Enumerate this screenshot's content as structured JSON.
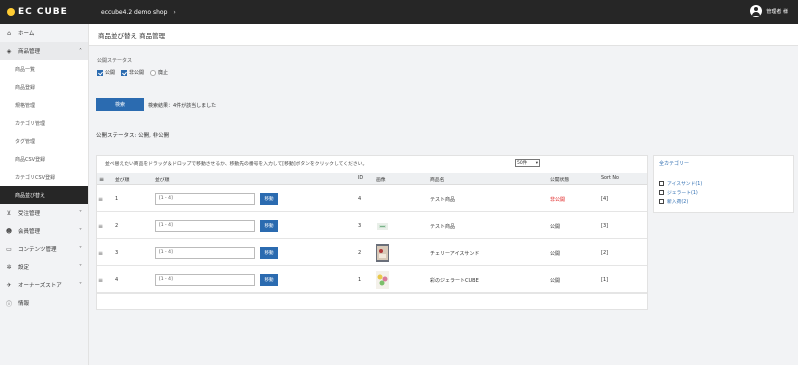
{
  "header": {
    "logo": "EC CUBE",
    "shop_name": "eccube4.2 demo shop",
    "user_name": "管理者 様"
  },
  "sidebar": {
    "items": [
      {
        "label": "ホーム",
        "icon": "home-icon"
      },
      {
        "label": "商品管理",
        "icon": "tag-icon"
      },
      {
        "label": "受注管理",
        "icon": "cart-icon"
      },
      {
        "label": "会員管理",
        "icon": "users-icon"
      },
      {
        "label": "コンテンツ管理",
        "icon": "monitor-icon"
      },
      {
        "label": "設定",
        "icon": "gear-icon"
      },
      {
        "label": "オーナーズストア",
        "icon": "store-icon"
      },
      {
        "label": "情報",
        "icon": "info-icon"
      }
    ],
    "sub_items": [
      "商品一覧",
      "商品登録",
      "規格管理",
      "カテゴリ管理",
      "タグ管理",
      "商品CSV登録",
      "カテゴリCSV登録",
      "商品並び替え"
    ]
  },
  "page": {
    "title": "商品並び替え  商品管理",
    "filter_label": "公開ステータス",
    "checks": [
      {
        "label": "公開",
        "checked": true
      },
      {
        "label": "非公開",
        "checked": true
      },
      {
        "label": "廃止",
        "checked": false
      }
    ],
    "search_label": "検索",
    "result_text": "検索結果：4件が該当しました",
    "status_line": "公開ステータス: 公開, 非公開"
  },
  "table": {
    "note": "並べ替えたい商品をドラッグ＆ドロップで移動させるか、移動先の番号を入力して[移動]ボタンをクリックしてください。",
    "per_page": "50件",
    "headers": [
      "並び順",
      "並び順",
      "ID",
      "画像",
      "商品名",
      "公開状態",
      "Sort No"
    ],
    "rows": [
      {
        "rank": "1",
        "input": "[1 - 4]",
        "move": "移動",
        "id": "4",
        "name": "テスト商品",
        "status": "非公開",
        "sort_no": "[4]",
        "status_color": "#e02020"
      },
      {
        "rank": "2",
        "input": "[1 - 4]",
        "move": "移動",
        "id": "3",
        "name": "テスト商品",
        "status": "公開",
        "sort_no": "[3]",
        "status_color": "#333333"
      },
      {
        "rank": "3",
        "input": "[1 - 4]",
        "move": "移動",
        "id": "2",
        "name": "チェリーアイスサンド",
        "status": "公開",
        "sort_no": "[2]",
        "status_color": "#333333"
      },
      {
        "rank": "4",
        "input": "[1 - 4]",
        "move": "移動",
        "id": "1",
        "name": "彩のジェラートCUBE",
        "status": "公開",
        "sort_no": "[1]",
        "status_color": "#333333"
      }
    ]
  },
  "categories": {
    "title": "全カテゴリー",
    "items": [
      "アイスサンド(1)",
      "ジェラート(1)",
      "新入荷(2)"
    ]
  },
  "colors": {
    "accent": "#2b6bb0",
    "header": "#262626",
    "danger": "#e02020"
  }
}
